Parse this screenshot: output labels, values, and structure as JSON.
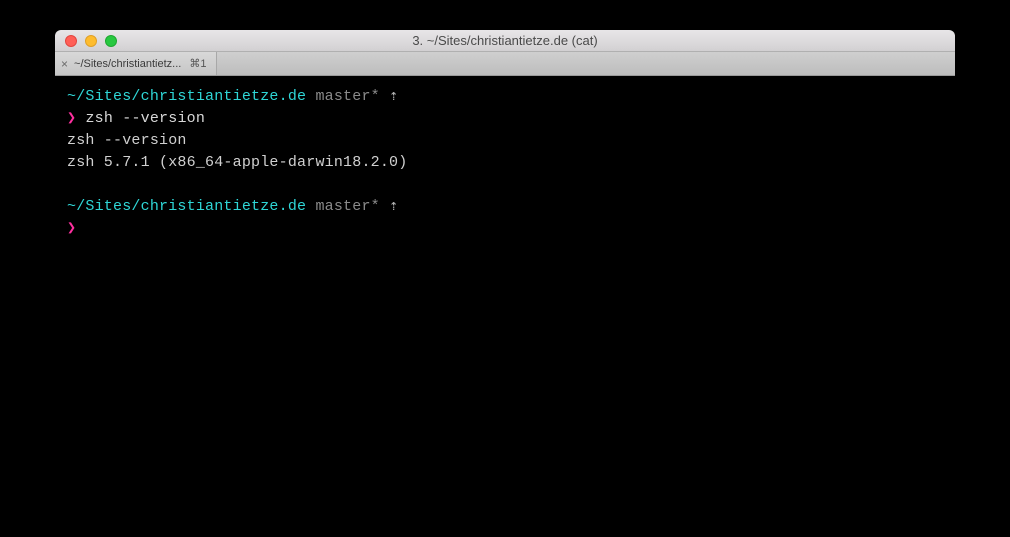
{
  "window": {
    "title": "3. ~/Sites/christiantietze.de (cat)"
  },
  "tab": {
    "label": "~/Sites/christiantietz...",
    "shortcut": "⌘1",
    "close_glyph": "×"
  },
  "prompt1": {
    "path": "~/Sites/christiantietze.de",
    "branch": "master*",
    "indicator": "⇡",
    "symbol": "❯",
    "command": "zsh --version"
  },
  "output": {
    "line1": "zsh --version",
    "line2": "zsh 5.7.1 (x86_64-apple-darwin18.2.0)"
  },
  "prompt2": {
    "path": "~/Sites/christiantietze.de",
    "branch": "master*",
    "indicator": "⇡",
    "symbol": "❯"
  }
}
